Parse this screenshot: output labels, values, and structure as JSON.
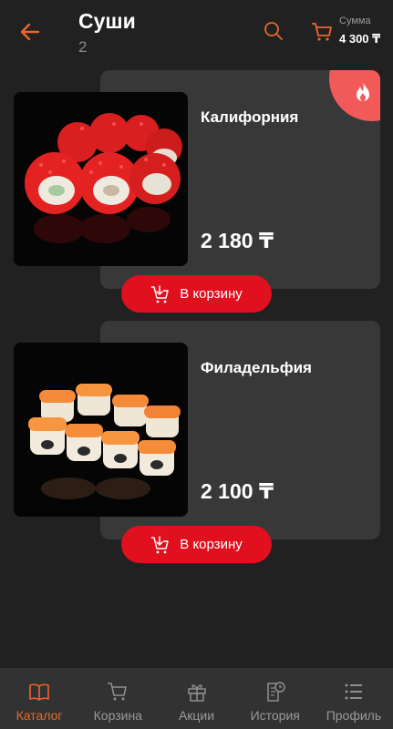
{
  "header": {
    "title": "Суши",
    "subtitle": "2",
    "sum_label": "Сумма",
    "sum_value": "4 300 ₸"
  },
  "products": [
    {
      "name": "Калифорния",
      "price": "2 180 ₸",
      "button_label": "В корзину",
      "badge": "hot-icon"
    },
    {
      "name": "Филадельфия",
      "price": "2 100 ₸",
      "button_label": "В корзину"
    }
  ],
  "nav": [
    {
      "label": "Каталог",
      "icon": "book-icon",
      "active": true
    },
    {
      "label": "Корзина",
      "icon": "cart-icon"
    },
    {
      "label": "Акции",
      "icon": "gift-icon"
    },
    {
      "label": "История",
      "icon": "history-icon"
    },
    {
      "label": "Профиль",
      "icon": "menu-icon"
    }
  ],
  "colors": {
    "accent": "#e8672c",
    "button": "#e0101f",
    "badge": "#f25a5a",
    "background": "#212121",
    "card": "#383838"
  }
}
